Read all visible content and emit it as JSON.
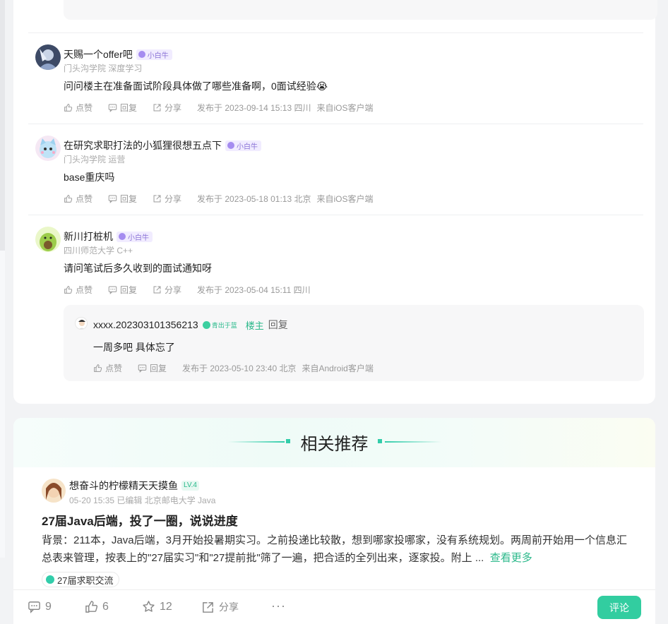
{
  "comments": [
    {
      "name": "天赐一个offer吧",
      "badge": "小白牛",
      "meta": "门头沟学院 深度学习",
      "text": "问问楼主在准备面试阶段具体做了哪些准备啊，0面试经验😭",
      "like": "点赞",
      "reply": "回复",
      "share": "分享",
      "time": "发布于 2023-09-14 15:13 四川",
      "source": "来自iOS客户端"
    },
    {
      "name": "在研究求职打法的小狐狸很想五点下",
      "badge": "小白牛",
      "meta": "门头沟学院 运营",
      "text": "base重庆吗",
      "like": "点赞",
      "reply": "回复",
      "share": "分享",
      "time": "发布于 2023-05-18 01:13 北京",
      "source": "来自iOS客户端"
    },
    {
      "name": "新川打桩机",
      "badge": "小白牛",
      "meta": "四川师范大学 C++",
      "text": "请问笔试后多久收到的面试通知呀",
      "like": "点赞",
      "reply": "回复",
      "share": "分享",
      "time": "发布于 2023-05-04 15:11 四川",
      "source": ""
    }
  ],
  "reply": {
    "name": "xxxx.202303101356213",
    "badge": "青出于蓝",
    "owner": "楼主",
    "verb": "回复",
    "text": "一周多吧 具体忘了",
    "like": "点赞",
    "reply": "回复",
    "time": "发布于 2023-05-10 23:40 北京",
    "source": "来自Android客户端"
  },
  "recommend": {
    "title": "相关推荐",
    "post": {
      "author": "想奋斗的柠檬精天天摸鱼",
      "level": "LV.4",
      "meta": "05-20 15:35  已编辑  北京邮电大学 Java",
      "title": "27届Java后端，投了一圈，说说进度",
      "body": "背景：211本，Java后端，3月开始投暑期实习。之前投递比较散，想到哪家投哪家，没有系统规划。两周前开始用一个信息汇总表来管理，按表上的\"27届实习\"和\"27提前批\"筛了一遍，把合适的全列出来，逐家投。附上 ...",
      "more": "查看更多",
      "tag": "27届求职交流"
    }
  },
  "bottom_bar": {
    "comments": "9",
    "likes": "6",
    "stars": "12",
    "share": "分享",
    "more": "···",
    "comment_button": "评论"
  },
  "colors": {
    "accent": "#32cda0",
    "badge_purple": "#8a72d6"
  }
}
